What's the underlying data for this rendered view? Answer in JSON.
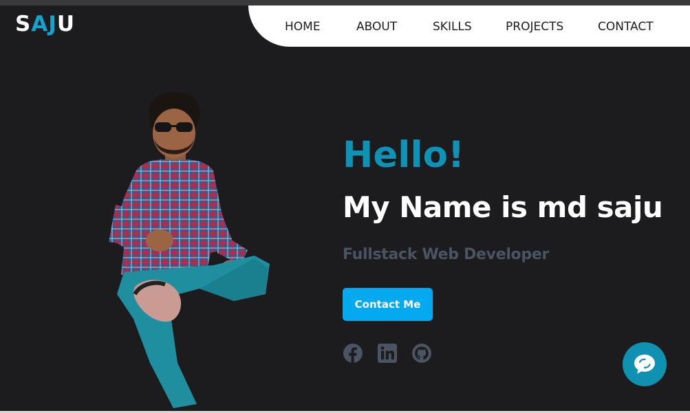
{
  "logo": {
    "part1": "S",
    "part2": "AJ",
    "part3": "U"
  },
  "nav": {
    "items": [
      {
        "label": "HOME"
      },
      {
        "label": "ABOUT"
      },
      {
        "label": "SKILLS"
      },
      {
        "label": "PROJECTS"
      },
      {
        "label": "CONTACT"
      }
    ]
  },
  "hero": {
    "greeting": "Hello!",
    "headline": "My Name is md saju",
    "role": "Fullstack Web Developer",
    "cta_label": "Contact Me",
    "social_icons": [
      "facebook-icon",
      "linkedin-icon",
      "github-icon"
    ]
  },
  "chat": {
    "icon": "chat-bubble-icon"
  },
  "colors": {
    "background": "#1c1b1e",
    "accent": "#0e93b7",
    "button": "#05a9f0",
    "nav_bg": "#ffffff",
    "muted_text": "#4a5463"
  }
}
